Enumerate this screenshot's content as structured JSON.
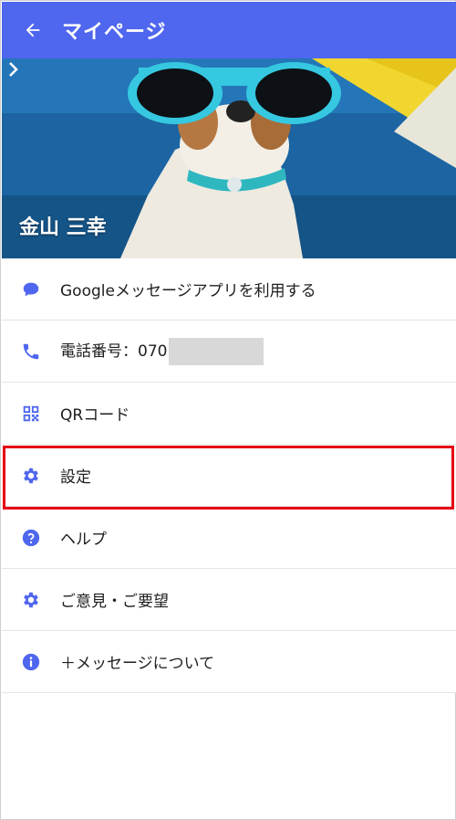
{
  "app_bar": {
    "title": "マイページ",
    "back_icon": "arrow-left-icon"
  },
  "profile": {
    "name": "金山 三幸",
    "chevron_icon": "chevron-right-icon"
  },
  "menu": [
    {
      "icon": "message-bubble-icon",
      "label": "Googleメッセージアプリを利用する"
    },
    {
      "icon": "phone-icon",
      "label": "電話番号：070"
    },
    {
      "icon": "qr-code-icon",
      "label": "QRコード"
    },
    {
      "icon": "gear-icon",
      "label": "設定"
    },
    {
      "icon": "help-circle-icon",
      "label": "ヘルプ"
    },
    {
      "icon": "gear-icon",
      "label": "ご意見・ご要望"
    },
    {
      "icon": "info-icon",
      "label": "＋メッセージについて"
    }
  ],
  "colors": {
    "accent": "#4f66ee",
    "highlight": "#e60012"
  }
}
